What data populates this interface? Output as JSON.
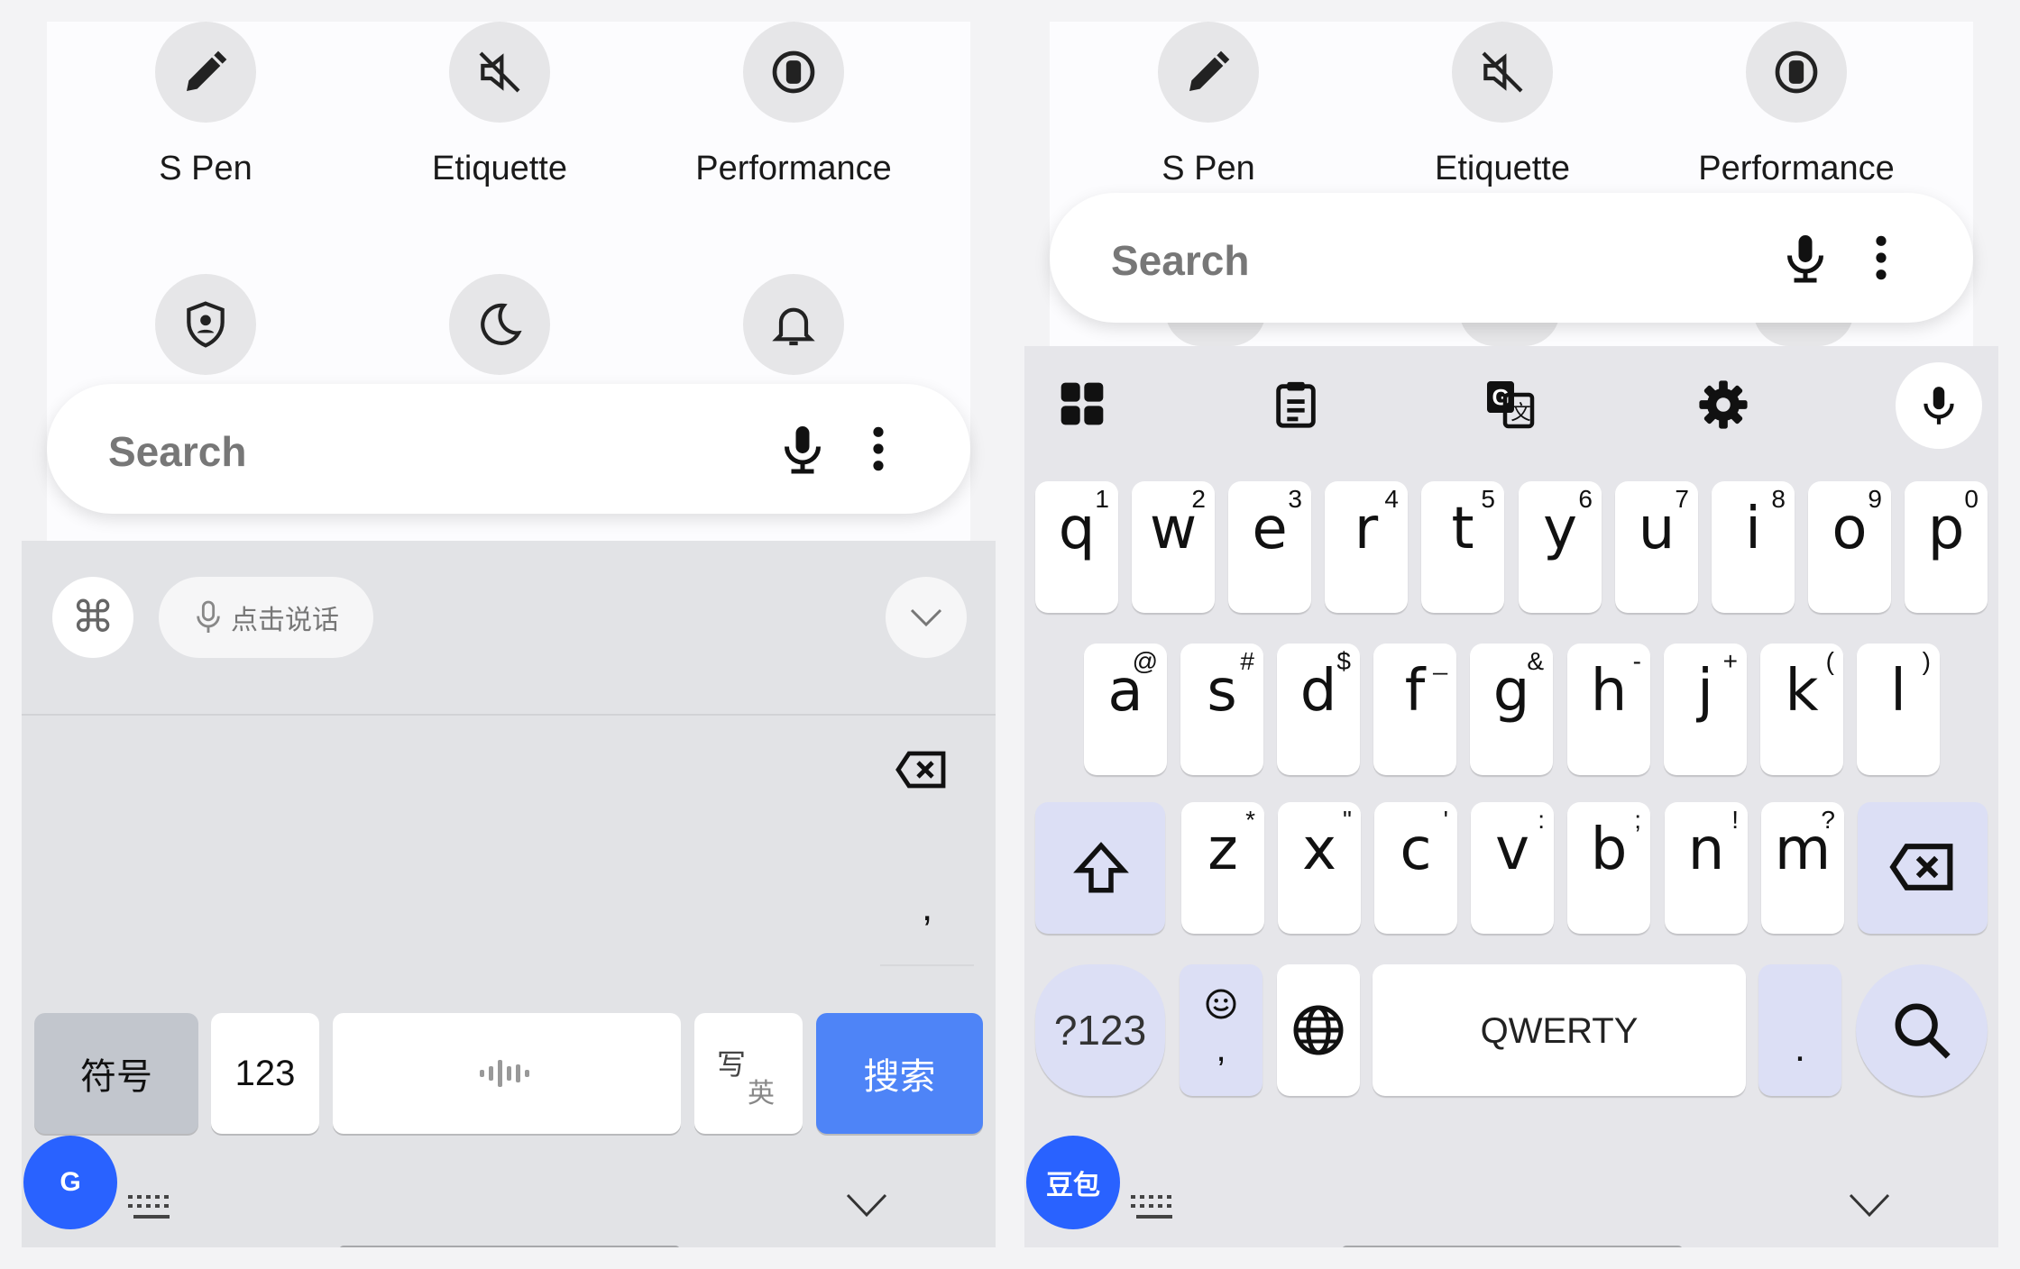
{
  "left": {
    "quick_settings_row1": [
      {
        "label": "S Pen",
        "icon": "pen-icon"
      },
      {
        "label": "Etiquette",
        "icon": "mute-icon"
      },
      {
        "label": "Performance",
        "icon": "performance-icon"
      }
    ],
    "quick_settings_row2_icons": [
      "security-icon",
      "moon-icon",
      "bell-icon"
    ],
    "search": {
      "placeholder": "Search"
    },
    "toolbar": {
      "voice_label": "点击说话"
    },
    "comma_key": ",",
    "bottom_keys": {
      "symbols": "符号",
      "numbers": "123",
      "write_line1": "写",
      "write_line2": "英",
      "search": "搜索"
    },
    "floating_button": "G",
    "colors": {
      "accent": "#4e84f7",
      "float": "#2962ff"
    }
  },
  "right": {
    "quick_settings_row1": [
      {
        "label": "S Pen",
        "icon": "pen-icon"
      },
      {
        "label": "Etiquette",
        "icon": "mute-icon"
      },
      {
        "label": "Performance",
        "icon": "performance-icon"
      }
    ],
    "search": {
      "placeholder": "Search"
    },
    "toolbar_icons": [
      "apps-grid-icon",
      "clipboard-icon",
      "translate-icon",
      "settings-gear-icon",
      "mic-icon"
    ],
    "rows": [
      [
        {
          "k": "q",
          "h": "1"
        },
        {
          "k": "w",
          "h": "2"
        },
        {
          "k": "e",
          "h": "3"
        },
        {
          "k": "r",
          "h": "4"
        },
        {
          "k": "t",
          "h": "5"
        },
        {
          "k": "y",
          "h": "6"
        },
        {
          "k": "u",
          "h": "7"
        },
        {
          "k": "i",
          "h": "8"
        },
        {
          "k": "o",
          "h": "9"
        },
        {
          "k": "p",
          "h": "0"
        }
      ],
      [
        {
          "k": "a",
          "h": "@"
        },
        {
          "k": "s",
          "h": "#"
        },
        {
          "k": "d",
          "h": "$"
        },
        {
          "k": "f",
          "h": "_"
        },
        {
          "k": "g",
          "h": "&"
        },
        {
          "k": "h",
          "h": "-"
        },
        {
          "k": "j",
          "h": "+"
        },
        {
          "k": "k",
          "h": "("
        },
        {
          "k": "l",
          "h": ")"
        }
      ],
      [
        {
          "k": "z",
          "h": "*"
        },
        {
          "k": "x",
          "h": "\""
        },
        {
          "k": "c",
          "h": "'"
        },
        {
          "k": "v",
          "h": ":"
        },
        {
          "k": "b",
          "h": ";"
        },
        {
          "k": "n",
          "h": "!"
        },
        {
          "k": "m",
          "h": "?"
        }
      ]
    ],
    "bottom": {
      "sym": "?123",
      "emoji_comma": ",",
      "space": "QWERTY",
      "period": "."
    },
    "floating_button": "豆包"
  }
}
